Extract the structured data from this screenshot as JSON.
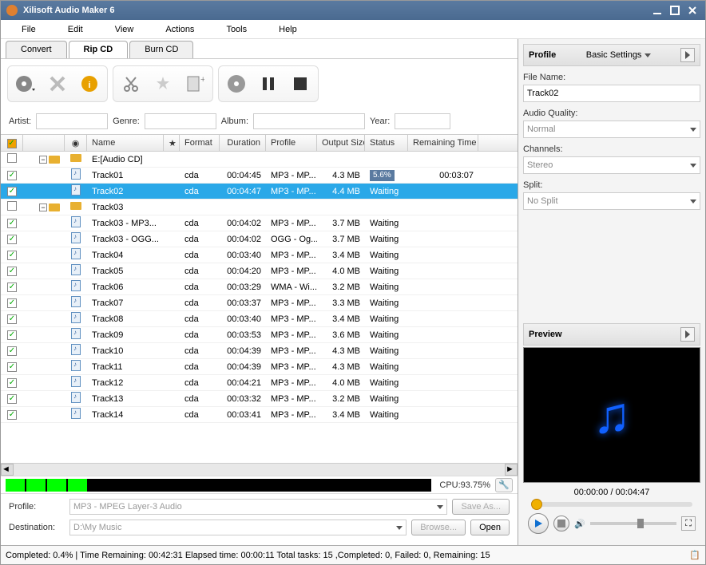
{
  "title": "Xilisoft Audio Maker 6",
  "menu": [
    "File",
    "Edit",
    "View",
    "Actions",
    "Tools",
    "Help"
  ],
  "tabs": {
    "items": [
      "Convert",
      "Rip CD",
      "Burn CD"
    ],
    "active": 1
  },
  "meta": {
    "artist_label": "Artist:",
    "artist": "",
    "genre_label": "Genre:",
    "genre": "",
    "album_label": "Album:",
    "album": "",
    "year_label": "Year:",
    "year": ""
  },
  "columns": [
    "",
    "",
    "",
    "Name",
    "",
    "Format",
    "Duration",
    "Profile",
    "Output Size",
    "Status",
    "Remaining Time"
  ],
  "tracks": [
    {
      "check": false,
      "icon": "folder",
      "expand": "-",
      "name": "E:[Audio CD]",
      "format": "",
      "duration": "",
      "profile": "",
      "output": "",
      "status": "",
      "remain": ""
    },
    {
      "check": true,
      "icon": "audio",
      "indent": true,
      "name": "Track01",
      "format": "cda",
      "duration": "00:04:45",
      "profile": "MP3 - MP...",
      "output": "4.3 MB",
      "status_pct": "5.6%",
      "remain": "00:03:07"
    },
    {
      "check": true,
      "icon": "audio",
      "indent": true,
      "selected": true,
      "name": "Track02",
      "format": "cda",
      "duration": "00:04:47",
      "profile": "MP3 - MP...",
      "output": "4.4 MB",
      "status": "Waiting",
      "remain": ""
    },
    {
      "check": false,
      "icon": "audio",
      "expand": "-",
      "folder": true,
      "name": "Track03",
      "format": "",
      "duration": "",
      "profile": "",
      "output": "",
      "status": "",
      "remain": ""
    },
    {
      "check": true,
      "icon": "doc",
      "indent": true,
      "name": "Track03 - MP3...",
      "format": "cda",
      "duration": "00:04:02",
      "profile": "MP3 - MP...",
      "output": "3.7 MB",
      "status": "Waiting",
      "remain": ""
    },
    {
      "check": true,
      "icon": "doc",
      "indent": true,
      "name": "Track03 - OGG...",
      "format": "cda",
      "duration": "00:04:02",
      "profile": "OGG - Og...",
      "output": "3.7 MB",
      "status": "Waiting",
      "remain": ""
    },
    {
      "check": true,
      "icon": "audio",
      "name": "Track04",
      "format": "cda",
      "duration": "00:03:40",
      "profile": "MP3 - MP...",
      "output": "3.4 MB",
      "status": "Waiting",
      "remain": ""
    },
    {
      "check": true,
      "icon": "audio",
      "name": "Track05",
      "format": "cda",
      "duration": "00:04:20",
      "profile": "MP3 - MP...",
      "output": "4.0 MB",
      "status": "Waiting",
      "remain": ""
    },
    {
      "check": true,
      "icon": "audio",
      "name": "Track06",
      "format": "cda",
      "duration": "00:03:29",
      "profile": "WMA - Wi...",
      "output": "3.2 MB",
      "status": "Waiting",
      "remain": ""
    },
    {
      "check": true,
      "icon": "audio",
      "name": "Track07",
      "format": "cda",
      "duration": "00:03:37",
      "profile": "MP3 - MP...",
      "output": "3.3 MB",
      "status": "Waiting",
      "remain": ""
    },
    {
      "check": true,
      "icon": "audio",
      "name": "Track08",
      "format": "cda",
      "duration": "00:03:40",
      "profile": "MP3 - MP...",
      "output": "3.4 MB",
      "status": "Waiting",
      "remain": ""
    },
    {
      "check": true,
      "icon": "audio",
      "name": "Track09",
      "format": "cda",
      "duration": "00:03:53",
      "profile": "MP3 - MP...",
      "output": "3.6 MB",
      "status": "Waiting",
      "remain": ""
    },
    {
      "check": true,
      "icon": "audio",
      "name": "Track10",
      "format": "cda",
      "duration": "00:04:39",
      "profile": "MP3 - MP...",
      "output": "4.3 MB",
      "status": "Waiting",
      "remain": ""
    },
    {
      "check": true,
      "icon": "audio",
      "name": "Track11",
      "format": "cda",
      "duration": "00:04:39",
      "profile": "MP3 - MP...",
      "output": "4.3 MB",
      "status": "Waiting",
      "remain": ""
    },
    {
      "check": true,
      "icon": "audio",
      "name": "Track12",
      "format": "cda",
      "duration": "00:04:21",
      "profile": "MP3 - MP...",
      "output": "4.0 MB",
      "status": "Waiting",
      "remain": ""
    },
    {
      "check": true,
      "icon": "audio",
      "name": "Track13",
      "format": "cda",
      "duration": "00:03:32",
      "profile": "MP3 - MP...",
      "output": "3.2 MB",
      "status": "Waiting",
      "remain": ""
    },
    {
      "check": true,
      "icon": "audio",
      "name": "Track14",
      "format": "cda",
      "duration": "00:03:41",
      "profile": "MP3 - MP...",
      "output": "3.4 MB",
      "status": "Waiting",
      "remain": ""
    }
  ],
  "cpu": "CPU:93.75%",
  "bottom": {
    "profile_label": "Profile:",
    "profile_value": "MP3 - MPEG Layer-3 Audio",
    "saveas": "Save As...",
    "dest_label": "Destination:",
    "dest_value": "D:\\My Music",
    "browse": "Browse...",
    "open": "Open"
  },
  "status": "Completed: 0.4% | Time Remaining: 00:42:31 Elapsed time: 00:00:11 Total tasks: 15 ,Completed: 0, Failed: 0, Remaining: 15",
  "profile_panel": {
    "title": "Profile",
    "settings": "Basic Settings",
    "filename_label": "File Name:",
    "filename": "Track02",
    "quality_label": "Audio Quality:",
    "quality": "Normal",
    "channels_label": "Channels:",
    "channels": "Stereo",
    "split_label": "Split:",
    "split": "No Split"
  },
  "preview": {
    "title": "Preview",
    "time": "00:00:00 / 00:04:47"
  }
}
